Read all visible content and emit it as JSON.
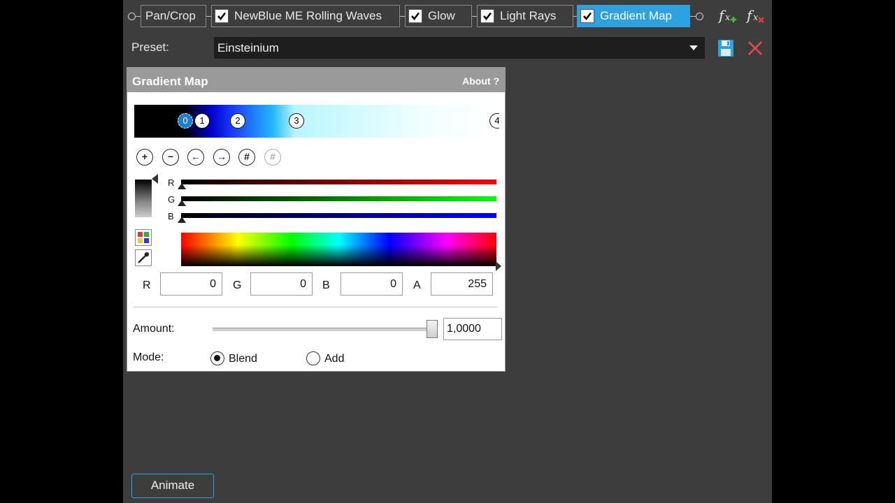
{
  "effect_chain": [
    {
      "label": "Pan/Crop",
      "has_checkbox": false,
      "active": false
    },
    {
      "label": "NewBlue ME Rolling Waves",
      "has_checkbox": true,
      "active": false
    },
    {
      "label": "Glow",
      "has_checkbox": true,
      "active": false
    },
    {
      "label": "Light Rays",
      "has_checkbox": true,
      "active": false
    },
    {
      "label": "Gradient Map",
      "has_checkbox": true,
      "active": true
    }
  ],
  "preset": {
    "label": "Preset:",
    "value": "Einsteinium"
  },
  "gradient_map": {
    "title": "Gradient Map",
    "about": "About   ?",
    "stops": [
      "0",
      "1",
      "2",
      "3",
      "4"
    ],
    "channels": [
      "R",
      "G",
      "B"
    ],
    "rgba": {
      "r_label": "R",
      "r": "0",
      "g_label": "G",
      "g": "0",
      "b_label": "B",
      "b": "0",
      "a_label": "A",
      "a": "255"
    },
    "amount_label": "Amount:",
    "amount_value": "1,0000",
    "amount_fraction": 1.0,
    "mode_label": "Mode:",
    "mode_options": [
      "Blend",
      "Add"
    ],
    "mode_selected": "Blend"
  },
  "animate_label": "Animate",
  "colors": {
    "accent": "#2ea2e0",
    "panel": "#3d3d3d",
    "header": "#9a9a9a"
  }
}
